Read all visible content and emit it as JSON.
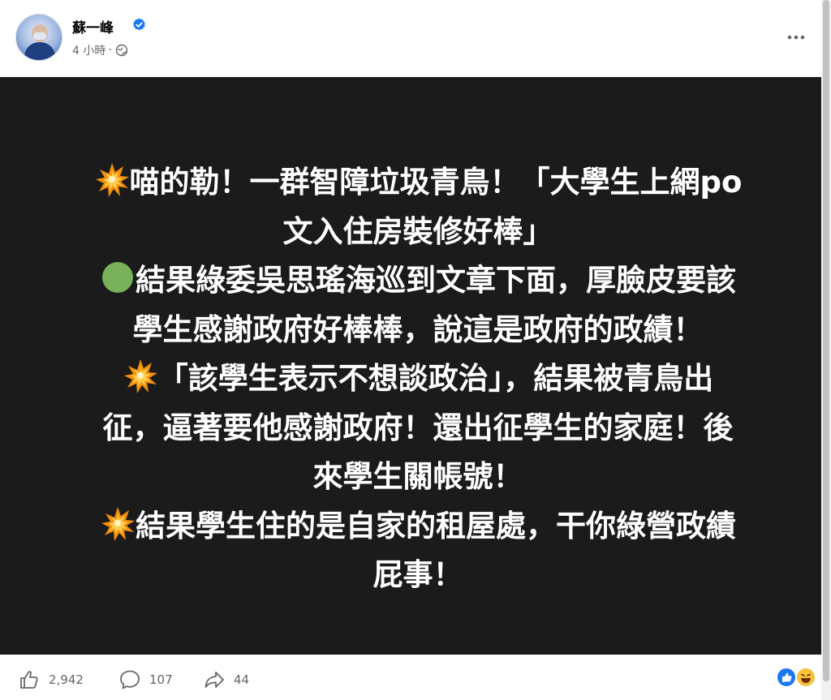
{
  "author": {
    "name": "蘇一峰",
    "time": "4 小時",
    "separator": "·",
    "avatar_icon": "profile-photo",
    "verified_icon": "verified-badge-icon"
  },
  "post": {
    "background": "#1b1b1b",
    "lines": [
      {
        "emoji": "collision",
        "text": "喵的勒！一群智障垃圾青鳥！「大學生上網po"
      },
      {
        "emoji": "",
        "text": "文入住房裝修好棒」"
      },
      {
        "emoji": "green-circle",
        "text": "結果綠委吳思瑤海巡到文章下面，厚臉皮要該"
      },
      {
        "emoji": "",
        "text": "學生感謝政府好棒棒，說這是政府的政績！"
      },
      {
        "emoji": "collision",
        "text": "「該學生表示不想談政治」，結果被青鳥出"
      },
      {
        "emoji": "",
        "text": "征，逼著要他感謝政府！還出征學生的家庭！後"
      },
      {
        "emoji": "",
        "text": "來學生關帳號！"
      },
      {
        "emoji": "collision",
        "text": "結果學生住的是自家的租屋處，干你綠營政績"
      },
      {
        "emoji": "",
        "text": "屁事！"
      }
    ]
  },
  "stats": {
    "likes": "2,942",
    "comments": "107",
    "shares": "44"
  },
  "colors": {
    "accent": "#1877f2",
    "meta": "#65676b"
  }
}
